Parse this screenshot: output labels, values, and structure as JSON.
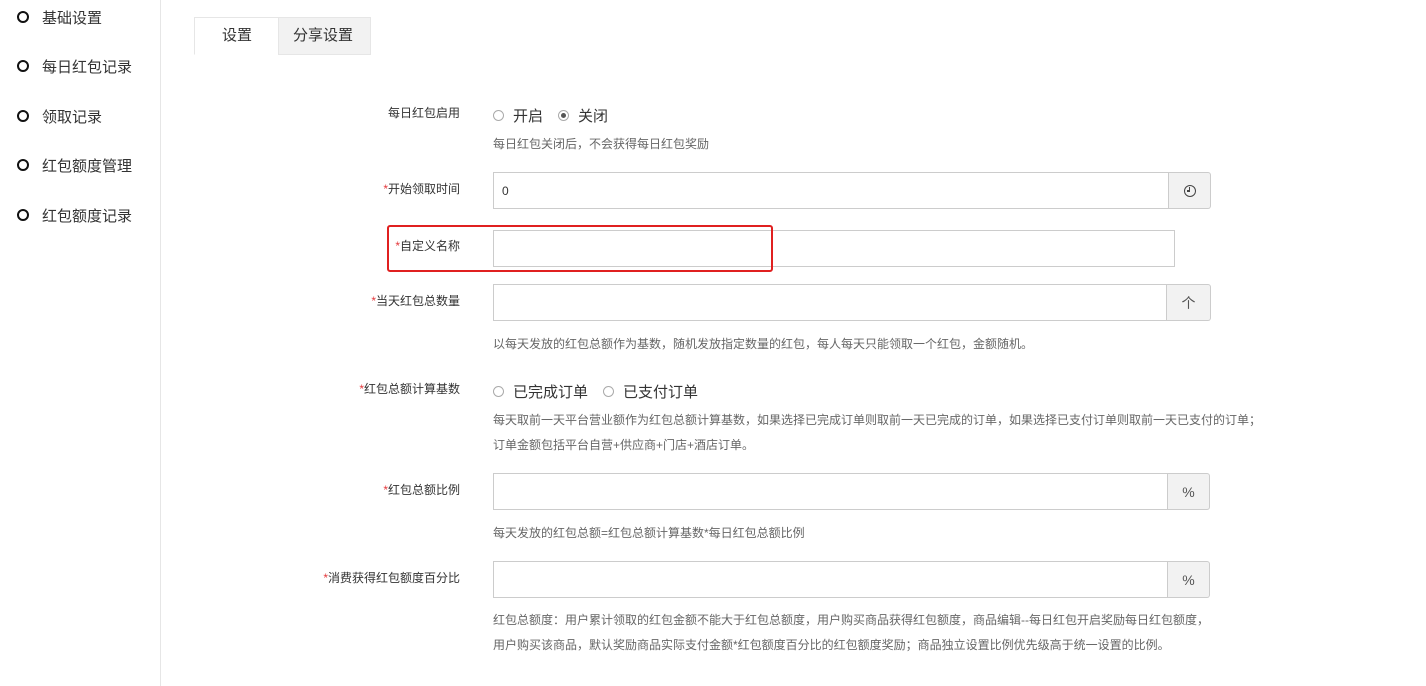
{
  "sidebar": {
    "items": [
      {
        "label": "基础设置"
      },
      {
        "label": "每日红包记录"
      },
      {
        "label": "领取记录"
      },
      {
        "label": "红包额度管理"
      },
      {
        "label": "红包额度记录"
      }
    ]
  },
  "tabs": [
    {
      "label": "设置",
      "active": true
    },
    {
      "label": "分享设置",
      "active": false
    }
  ],
  "form": {
    "enable": {
      "label": "每日红包启用",
      "options": [
        "开启",
        "关闭"
      ],
      "selected": "关闭",
      "help": "每日红包关闭后，不会获得每日红包奖励"
    },
    "start_time": {
      "label": "开始领取时间",
      "value": "0",
      "icon": "clock-icon"
    },
    "custom_name": {
      "label": "自定义名称",
      "value": ""
    },
    "total_count": {
      "label": "当天红包总数量",
      "value": "",
      "unit": "个",
      "help": "以每天发放的红包总额作为基数，随机发放指定数量的红包，每人每天只能领取一个红包，金额随机。"
    },
    "base": {
      "label": "红包总额计算基数",
      "options": [
        "已完成订单",
        "已支付订单"
      ],
      "help_line1": "每天取前一天平台营业额作为红包总额计算基数，如果选择已完成订单则取前一天已完成的订单，如果选择已支付订单则取前一天已支付的订单；",
      "help_line2": "订单金额包括平台自营+供应商+门店+酒店订单。"
    },
    "ratio": {
      "label": "红包总额比例",
      "value": "",
      "unit": "%",
      "help": "每天发放的红包总额=红包总额计算基数*每日红包总额比例"
    },
    "consume_ratio": {
      "label": "消费获得红包额度百分比",
      "value": "",
      "unit": "%",
      "help_line1": "红包总额度：用户累计领取的红包金额不能大于红包总额度，用户购买商品获得红包额度，商品编辑--每日红包开启奖励每日红包额度，",
      "help_line2": "用户购买该商品，默认奖励商品实际支付金额*红包额度百分比的红包额度奖励；商品独立设置比例优先级高于统一设置的比例。"
    },
    "required_mark": "*"
  },
  "colors": {
    "required": "#e4393c",
    "highlight": "#e02020"
  }
}
